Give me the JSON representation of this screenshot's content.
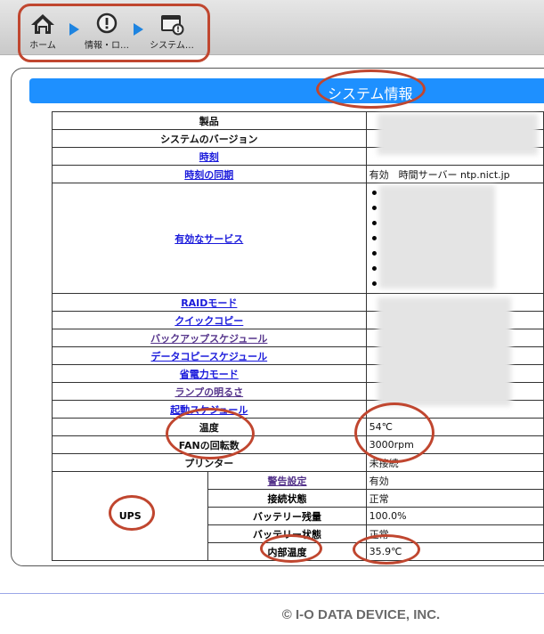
{
  "breadcrumb": {
    "home": "ホーム",
    "info": "情報・ロ…",
    "system": "システム…"
  },
  "page_title": "システム情報",
  "rows": {
    "product": "製品",
    "system_version": "システムのバージョン",
    "time": "時刻",
    "time_sync": "時刻の同期",
    "time_sync_value": "有効　時間サーバー ntp.nict.jp",
    "services": "有効なサービス",
    "raid_mode": "RAIDモード",
    "quick_copy": "クイックコピー",
    "backup_schedule": "バックアップスケジュール",
    "data_copy_schedule": "データコピースケジュール",
    "power_saving": "省電力モード",
    "lamp_brightness": "ランプの明るさ",
    "boot_schedule": "起動スケジュール",
    "temperature": "温度",
    "temperature_value": "54℃",
    "fan_speed": "FANの回転数",
    "fan_speed_value": "3000rpm",
    "printer": "プリンター",
    "printer_value": "未接続"
  },
  "ups": {
    "label": "UPS",
    "warning_settings": "警告設定",
    "warning_settings_value": "有効",
    "connection_status": "接続状態",
    "connection_status_value": "正常",
    "battery_remaining": "バッテリー残量",
    "battery_remaining_value": "100.0%",
    "battery_status": "バッテリー状態",
    "battery_status_value": "正常",
    "internal_temp": "内部温度",
    "internal_temp_value": "35.9℃"
  },
  "footer": "© I-O DATA DEVICE, INC.",
  "colors": {
    "title_bar": "#1e90ff",
    "link": "#1a1adb",
    "visited_link": "#55348b",
    "annotation": "#c0462f",
    "breadcrumb_arrow": "#1e84e0"
  },
  "icons": [
    "home-icon",
    "info-icon",
    "system-icon"
  ]
}
